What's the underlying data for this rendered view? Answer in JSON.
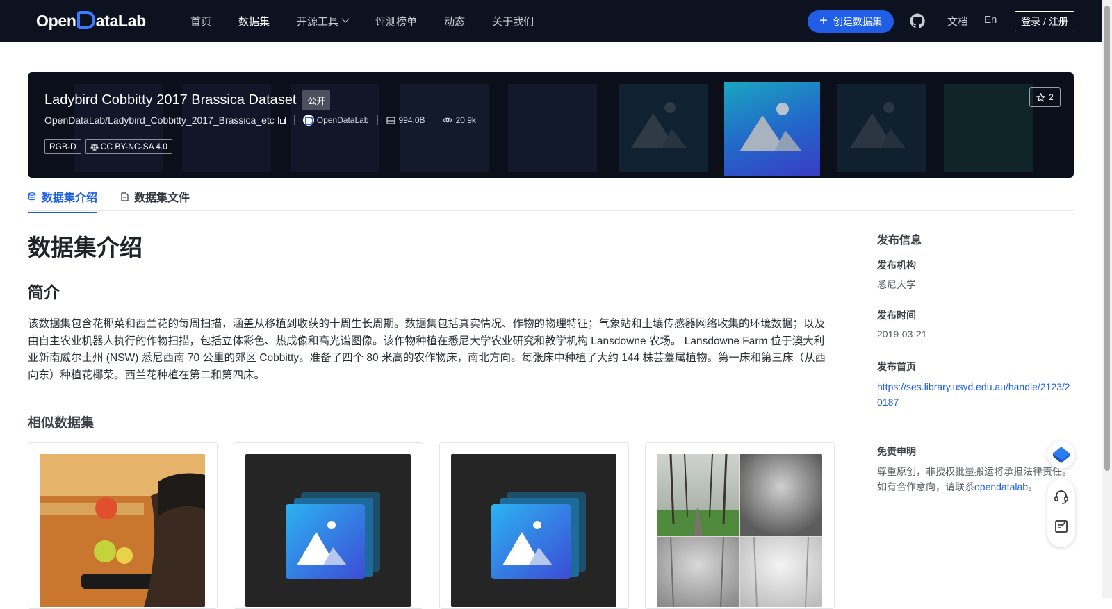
{
  "nav": {
    "logo_text_1": "Open",
    "logo_text_2": "ataLab",
    "items": [
      "首页",
      "数据集",
      "开源工具",
      "评测榜单",
      "动态",
      "关于我们"
    ],
    "create_label": "创建数据集",
    "doc_label": "文档",
    "lang_label": "En",
    "login_label": "登录 / 注册"
  },
  "dataset": {
    "title": "Ladybird Cobbitty 2017 Brassica Dataset",
    "visibility": "公开",
    "repo": "OpenDataLab/Ladybird_Cobbitty_2017_Brassica_etc",
    "publisher": "OpenDataLab",
    "size": "994.0B",
    "views": "20.9k",
    "tags": [
      "RGB-D",
      "CC BY-NC-SA 4.0"
    ],
    "stars": "2"
  },
  "tabs": {
    "intro": "数据集介绍",
    "files": "数据集文件"
  },
  "content": {
    "heading": "数据集介绍",
    "subheading": "简介",
    "description": "该数据集包含花椰菜和西兰花的每周扫描，涵盖从移植到收获的十周生长周期。数据集包括真实情况、作物的物理特征；气象站和土壤传感器网络收集的环境数据；以及由自主农业机器人执行的作物扫描，包括立体彩色、热成像和高光谱图像。该作物种植在悉尼大学农业研究和教学机构 Lansdowne 农场。 Lansdowne Farm 位于澳大利亚新南威尔士州 (NSW) 悉尼西南 70 公里的郊区 Cobbitty。准备了四个 80 米高的农作物床，南北方向。每张床中种植了大约 144 株芸薹属植物。第一床和第三床（从西向东）种植花椰菜。西兰花种植在第二和第四床。",
    "similar_heading": "相似数据集"
  },
  "sidebar": {
    "title": "发布信息",
    "org_label": "发布机构",
    "org_value": "悉尼大学",
    "time_label": "发布时间",
    "time_value": "2019-03-21",
    "home_label": "发布首页",
    "home_url": "https://ses.library.usyd.edu.au/handle/2123/20187",
    "disclaimer_label": "免责申明",
    "disclaimer_text": "尊重原创，非授权批量搬运将承担法律责任。如有合作意向，请联系",
    "disclaimer_link": "opendatalab",
    "disclaimer_end": "。"
  },
  "icons": [
    "plus-icon",
    "github-icon",
    "copy-icon",
    "storage-icon",
    "eye-icon",
    "license-icon",
    "star-icon",
    "database-icon",
    "file-icon",
    "placeholder-image-icon",
    "support-icon",
    "feedback-icon"
  ],
  "colors": {
    "accent": "#1d5fe6",
    "nav_bg": "#0c1220",
    "banner_bg": "#0b0f19"
  }
}
